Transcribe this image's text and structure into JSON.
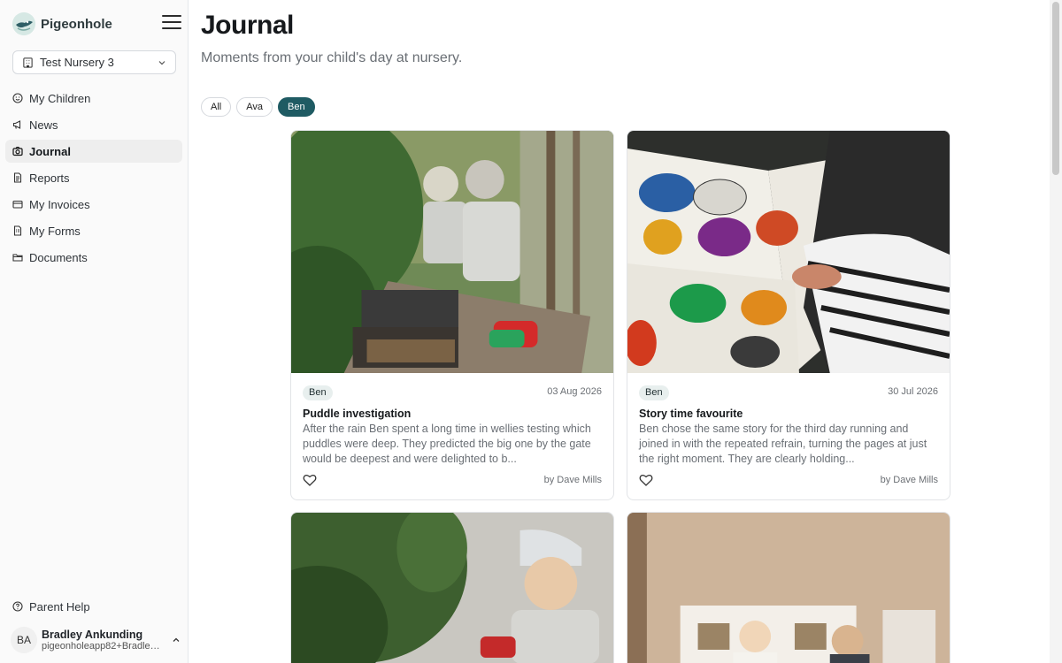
{
  "brand": {
    "name": "Pigeonhole"
  },
  "nursery": {
    "selected": "Test Nursery 3"
  },
  "nav": {
    "items": [
      {
        "label": "My Children"
      },
      {
        "label": "News"
      },
      {
        "label": "Journal"
      },
      {
        "label": "Reports"
      },
      {
        "label": "My Invoices"
      },
      {
        "label": "My Forms"
      },
      {
        "label": "Documents"
      }
    ],
    "active": "Journal"
  },
  "help": {
    "label": "Parent Help"
  },
  "user": {
    "initials": "BA",
    "name": "Bradley Ankunding",
    "email": "pigeonholeapp82+Bradley..."
  },
  "page": {
    "title": "Journal",
    "subtitle": "Moments from your child's day at nursery."
  },
  "filters": {
    "chips": [
      "All",
      "Ava",
      "Ben"
    ],
    "selected": "Ben"
  },
  "cards": [
    {
      "tag": "Ben",
      "date": "03 Aug 2026",
      "title": "Puddle investigation",
      "text": "After the rain Ben spent a long time in wellies testing which puddles were deep. They predicted the big one by the gate would be deepest and were delighted to b...",
      "author": "by Dave Mills"
    },
    {
      "tag": "Ben",
      "date": "30 Jul 2026",
      "title": "Story time favourite",
      "text": "Ben chose the same story for the third day running and joined in with the repeated refrain, turning the pages at just the right moment. They are clearly holding...",
      "author": "by Dave Mills"
    }
  ],
  "colors": {
    "accent": "#1f5b63",
    "tag_bg": "#e8efee"
  },
  "icons": {
    "brand": "pigeon-logo-icon",
    "menu": "hamburger-icon",
    "nursery": "building-icon",
    "children": "smile-icon",
    "news": "megaphone-icon",
    "journal": "camera-icon",
    "reports": "document-icon",
    "invoices": "credit-card-icon",
    "forms": "form-icon",
    "documents": "folder-icon",
    "help": "help-circle-icon",
    "like": "heart-icon"
  }
}
